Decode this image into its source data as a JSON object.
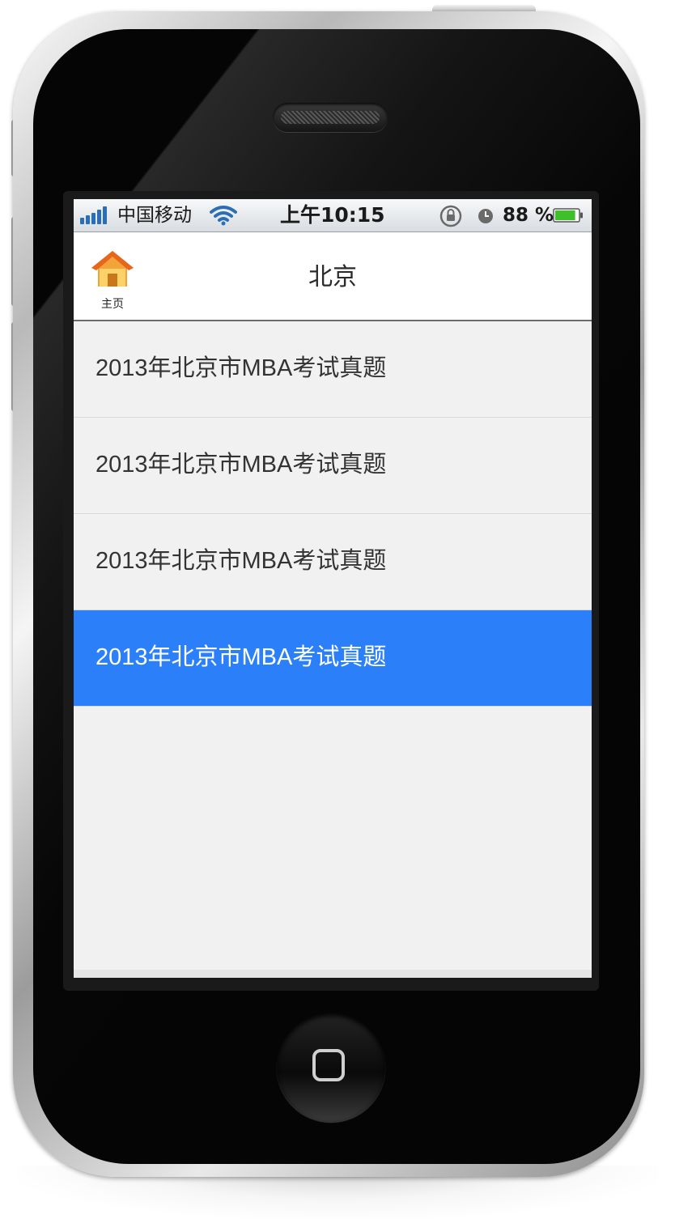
{
  "status_bar": {
    "carrier": "中国移动",
    "time": "上午10:15",
    "battery_percent": "88 %",
    "battery_level": 0.88,
    "icons": [
      "signal-icon",
      "wifi-icon",
      "rotation-lock-icon",
      "alarm-icon",
      "battery-icon"
    ]
  },
  "nav": {
    "home_label": "主页",
    "title": "北京"
  },
  "list": {
    "items": [
      {
        "label": "2013年北京市MBA考试真题",
        "selected": false
      },
      {
        "label": "2013年北京市MBA考试真题",
        "selected": false
      },
      {
        "label": "2013年北京市MBA考试真题",
        "selected": false
      },
      {
        "label": "2013年北京市MBA考试真题",
        "selected": true
      }
    ]
  },
  "colors": {
    "selected_row": "#2b7ff8",
    "list_bg": "#f1f1f1",
    "signal": "#2a6fb5",
    "battery": "#3fbf2a",
    "home_roof": "#e8661c"
  }
}
